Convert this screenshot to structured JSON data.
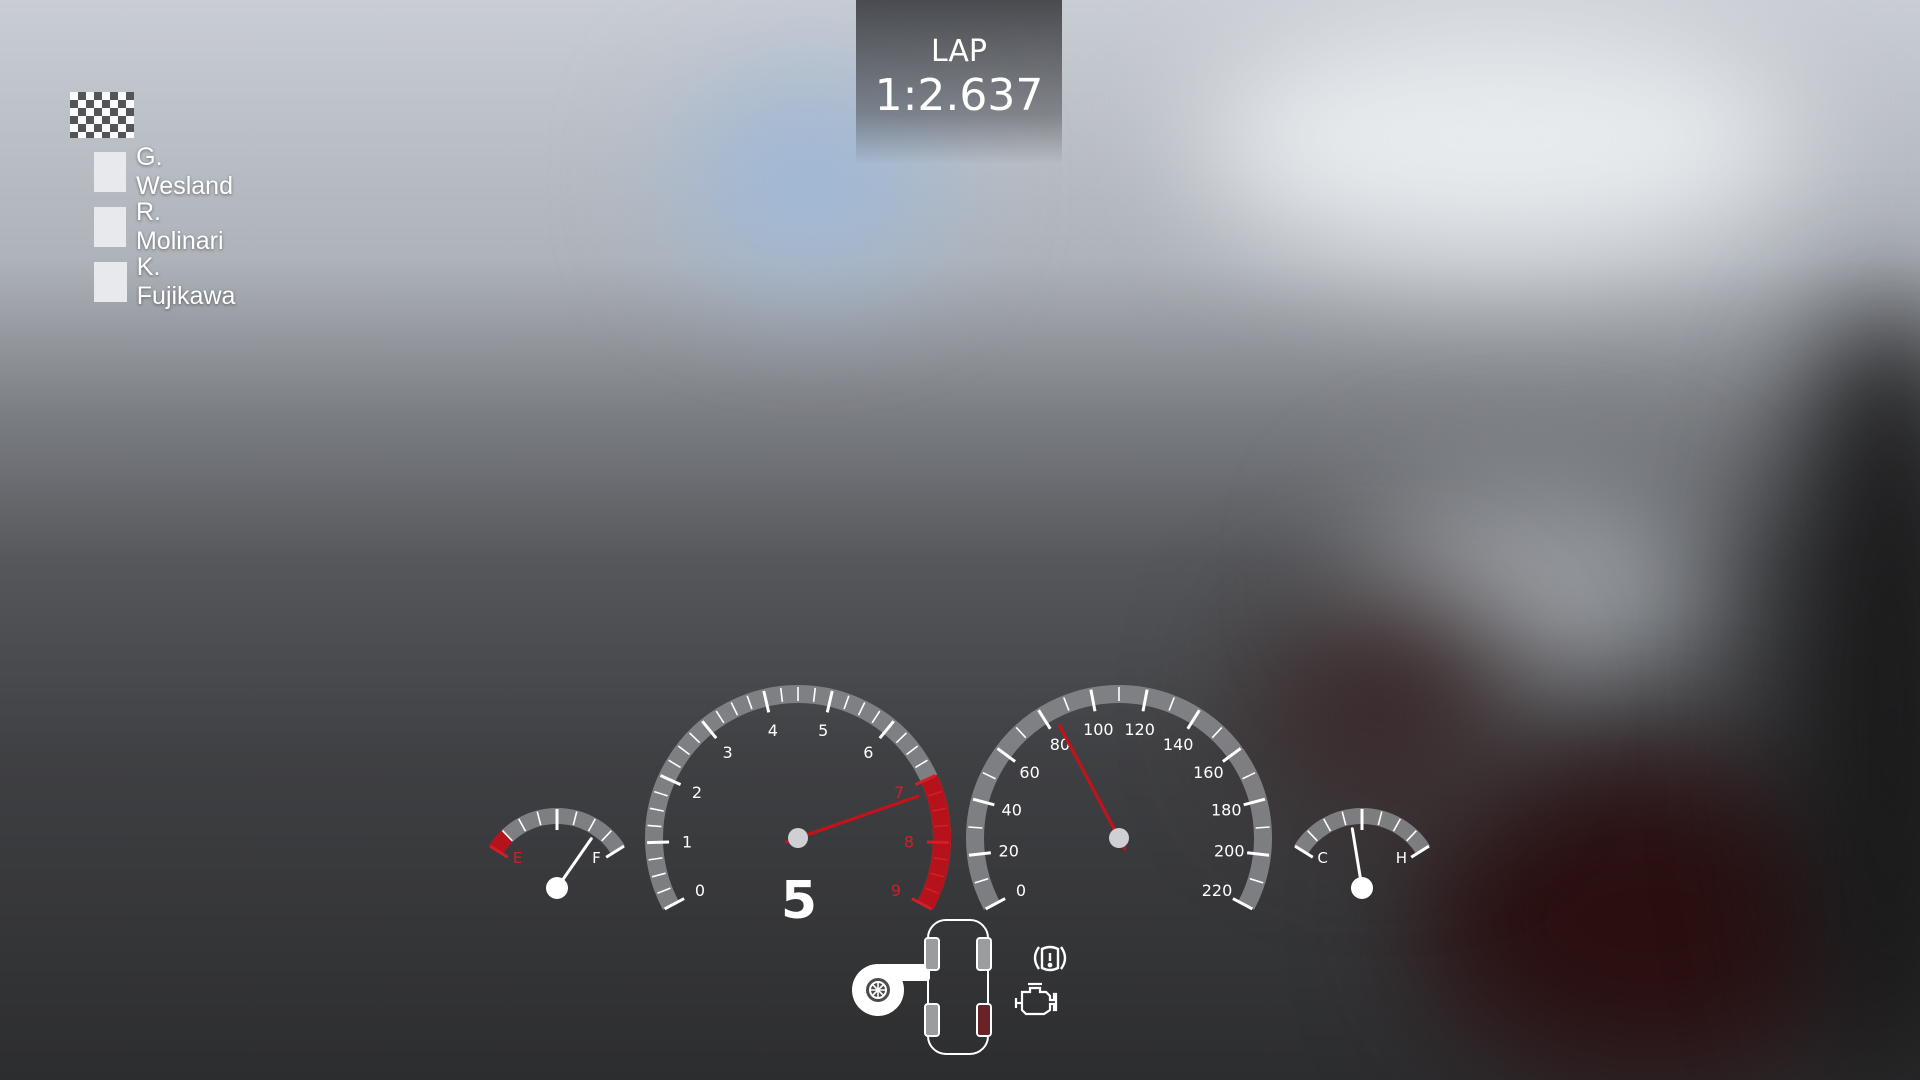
{
  "lap": {
    "label": "LAP",
    "time": "1:2.637"
  },
  "standings": [
    {
      "name": "G. Wesland"
    },
    {
      "name": "R. Molinari"
    },
    {
      "name": "K. Fujikawa"
    }
  ],
  "fuel_gauge": {
    "min_label": "E",
    "max_label": "F",
    "level": 0.8
  },
  "temp_gauge": {
    "min_label": "C",
    "max_label": "H",
    "level": 0.42
  },
  "tachometer": {
    "labels": [
      "0",
      "1",
      "2",
      "3",
      "4",
      "5",
      "6",
      "7",
      "8",
      "9"
    ],
    "redline_from": 7,
    "value": 7.2,
    "gear": "5"
  },
  "speedometer": {
    "labels": [
      "0",
      "20",
      "40",
      "60",
      "80",
      "100",
      "120",
      "140",
      "160",
      "180",
      "200",
      "220"
    ],
    "value": 84
  },
  "tire_status": {
    "front_left": "ok",
    "front_right": "ok",
    "rear_left": "ok",
    "rear_right": "warning"
  },
  "icons": [
    "turbo-icon",
    "car-outline-icon",
    "tire-pressure-warning-icon",
    "check-engine-icon",
    "checkered-flag-icon"
  ],
  "colors": {
    "needle": "#c4121a",
    "redzone": "#b5121b",
    "warning_tire": "#6a2226",
    "text": "#ffffff"
  }
}
